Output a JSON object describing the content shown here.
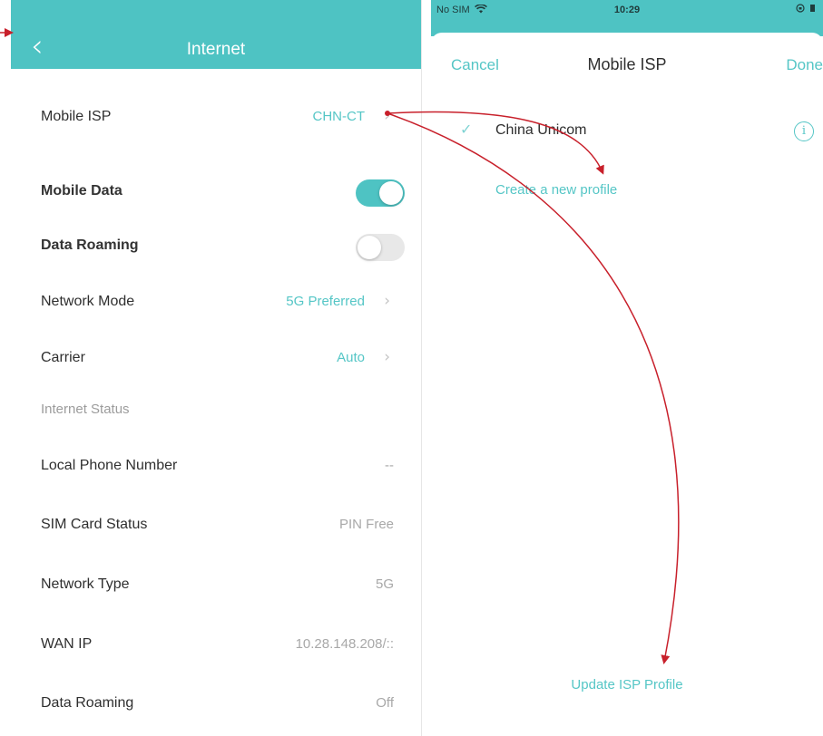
{
  "left_screen": {
    "title": "Internet",
    "rows": [
      {
        "label": "Mobile ISP",
        "value": "CHN-CT",
        "chevron": true
      },
      {
        "label": "Mobile Data",
        "toggle": "on"
      },
      {
        "label": "Data Roaming",
        "toggle": "off"
      },
      {
        "label": "Network Mode",
        "value": "5G Preferred",
        "chevron": true
      },
      {
        "label": "Carrier",
        "value": "Auto",
        "chevron": true
      },
      {
        "label": "Internet Status"
      },
      {
        "label": "Local Phone Number",
        "value": "--"
      },
      {
        "label": "SIM Card Status",
        "value": "PIN Free"
      },
      {
        "label": "Network Type",
        "value": "5G"
      },
      {
        "label": "WAN IP",
        "value": "10.28.148.208/::"
      },
      {
        "label": "Data Roaming",
        "value": "Off"
      }
    ]
  },
  "right_screen": {
    "status_bar": {
      "carrier": "No SIM",
      "time": "10:29"
    },
    "nav": {
      "cancel": "Cancel",
      "title": "Mobile ISP",
      "done": "Done"
    },
    "isp_list": [
      {
        "name": "China Unicom",
        "selected": true
      }
    ],
    "create_profile": "Create a new profile",
    "update_profile": "Update ISP Profile"
  },
  "colors": {
    "accent": "#4ec3c3",
    "link": "#55c6c6",
    "annotation": "#c8202b"
  },
  "icons": [
    "back-chevron-icon",
    "chevron-right-icon",
    "wifi-icon",
    "battery-icon",
    "checkmark-icon",
    "info-icon"
  ]
}
